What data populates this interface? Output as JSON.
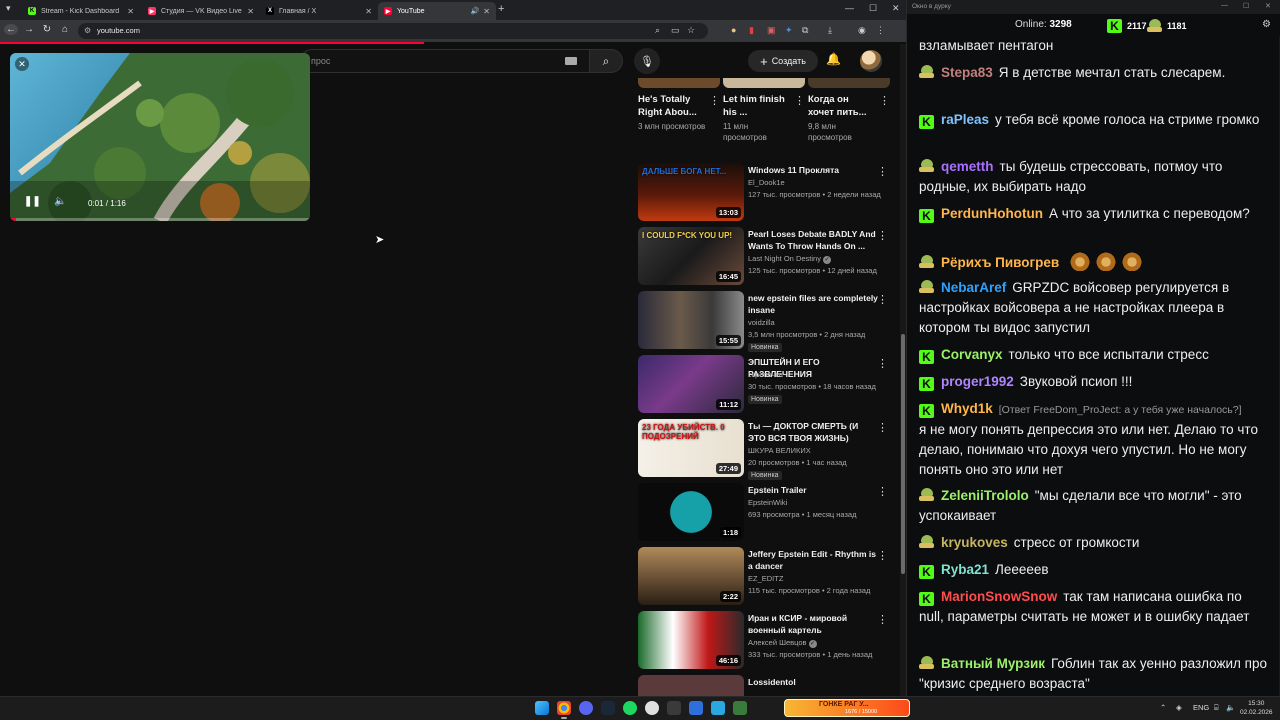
{
  "browser": {
    "tabs": [
      {
        "label": "Stream - Kick Dashboard",
        "fav_color": "#53fc18",
        "fav_glyph": "K",
        "active": false
      },
      {
        "label": "Студия — VK Видео Live",
        "fav_color": "#ff3366",
        "fav_glyph": "▶",
        "active": false
      },
      {
        "label": "Главная / X",
        "fav_color": "#ffffff",
        "fav_glyph": "X",
        "active": false
      },
      {
        "label": "YouTube",
        "fav_color": "#ff0033",
        "fav_glyph": "▶",
        "active": true
      }
    ],
    "new_tab_glyph": "+",
    "address": "youtube.com"
  },
  "youtube": {
    "search_placeholder": "прос",
    "create_label": "Создать",
    "miniplayer": {
      "time": "0:01 / 1:16",
      "progress": 0.02
    },
    "shorts": [
      {
        "title": "He's Totally Right Abou...",
        "views": "3 млн просмотров",
        "color": "#6b4b2a"
      },
      {
        "title": "Let him finish his ...",
        "views": "11 млн просмотров",
        "color": "#c9b99a"
      },
      {
        "title": "Когда он хочет пить...",
        "views": "9,8 млн просмотров",
        "color": "#4a3a2a"
      }
    ],
    "recommendations": [
      {
        "title": "Windows 11 Проклята",
        "channel": "El_Dook1e",
        "verified": false,
        "meta": "127 тыс. просмотров • 2 недели назад",
        "badge": "",
        "duration": "13:03",
        "thumb_text": "ДАЛЬШЕ БОГА НЕТ...",
        "thumb_bg": "linear-gradient(180deg,#1a0e0a,#5a1a0a 55%,#c23a10)",
        "accent": "#1e6fd9"
      },
      {
        "title": "Pearl Loses Debate BADLY And Wants To Throw Hands On ...",
        "channel": "Last Night On Destiny",
        "verified": true,
        "meta": "125 тыс. просмотров • 12 дней назад",
        "badge": "",
        "duration": "16:45",
        "thumb_text": "I COULD F*CK YOU UP!",
        "thumb_bg": "linear-gradient(135deg,#3a3a3a,#1a1a1a 50%,#6a4a3a)",
        "accent": "#f5d040"
      },
      {
        "title": "new epstein files are completely insane",
        "channel": "voidzilla",
        "verified": false,
        "meta": "3,5 млн просмотров • 2 дня назад",
        "badge": "Новинка",
        "duration": "15:55",
        "thumb_text": "",
        "thumb_bg": "linear-gradient(90deg,#2a2a3a,#6a5a4a 40%,#3a3a3a 70%,#8a8a8a)",
        "accent": "#c0b0a0"
      },
      {
        "title": "ЭПШТЕЙН И ЕГО РАЗВЛЕЧЕНИЯ",
        "channel": "скрепочка",
        "verified": false,
        "meta": "30 тыс. просмотров • 18 часов назад",
        "badge": "Новинка",
        "duration": "11:12",
        "thumb_text": "",
        "thumb_bg": "linear-gradient(135deg,#3a2a6a,#7a3a8a 45%,#2a2a3a)",
        "accent": "#e07a40"
      },
      {
        "title": "Ты — ДОКТОР СМЕРТЬ (И ЭТО ВСЯ ТВОЯ ЖИЗНЬ)",
        "channel": "ШКУРА ВЕЛИКИХ",
        "verified": false,
        "meta": "20 просмотров • 1 час назад",
        "badge": "Новинка",
        "duration": "27:49",
        "thumb_text": "23 ГОДА УБИЙСТВ. 0 ПОДОЗРЕНИЙ",
        "thumb_bg": "linear-gradient(90deg,#f4f0e8,#e8e0d0)",
        "accent": "#d01010"
      },
      {
        "title": "Epstein Trailer",
        "channel": "EpsteinWiki",
        "verified": false,
        "meta": "693 просмотра • 1 месяц назад",
        "badge": "",
        "duration": "1:18",
        "thumb_text": "",
        "thumb_bg": "radial-gradient(circle at 50% 50%,#16a0a8 0 34%,#0a0a0a 35%)",
        "accent": "#16a0a8"
      },
      {
        "title": "Jeffery Epstein Edit - Rhythm is a dancer",
        "channel": "EZ_EDITZ",
        "verified": false,
        "meta": "115 тыс. просмотров • 2 года назад",
        "badge": "",
        "duration": "2:22",
        "thumb_text": "",
        "thumb_bg": "linear-gradient(180deg,#b08a5a,#2a1e14)",
        "accent": "#1a1a1a"
      },
      {
        "title": "Иран и КСИР - мировой военный картель",
        "channel": "Алексей Шевцов",
        "verified": true,
        "meta": "333 тыс. просмотров • 1 день назад",
        "badge": "",
        "duration": "46:16",
        "thumb_text": "",
        "thumb_bg": "linear-gradient(90deg,#1a6a2a,#ffffff 33%,#c01818 66%,#2a2a2a)",
        "accent": "#e0c060"
      }
    ],
    "partial_title": "Lossidentol"
  },
  "chat_panel": {
    "window_title": "Окно в дурку",
    "online_label": "Online:",
    "online_count": "3298",
    "stat_kick": "2117",
    "stat_vk": "1181",
    "messages": [
      {
        "badge": "",
        "user": "",
        "color": "#efeff1",
        "text": "взламывает пентагон",
        "reply": ""
      },
      {
        "badge": "goblin",
        "user": "Stepa83",
        "color": "#c47f7f",
        "text": "Я в детстве мечтал стать слесарем.",
        "reply": ""
      },
      {
        "badge": "kick",
        "user": "raPleas",
        "color": "#7ec3ff",
        "text": "у тебя всё кроме голоса на стриме громко",
        "reply": ""
      },
      {
        "badge": "goblin",
        "user": "qemetth",
        "color": "#a970ff",
        "text": "ты будешь стрессовать, потмоу что родные, их выбирать надо",
        "reply": ""
      },
      {
        "badge": "kick",
        "user": "PerdunHohotun",
        "color": "#ffb64a",
        "text": "А что за утилитка с переводом?",
        "reply": ""
      },
      {
        "badge": "goblin",
        "user": "Рёрихъ Пивогрев",
        "color": "#ffb64a",
        "text": "",
        "reply": ""
      },
      {
        "badge": "goblin",
        "user": "NebarAref",
        "color": "#2fa2ff",
        "text": "GRPZDC войсовер регулируется в настройках войсовера а не настройках плеера в котором ты видос запустил",
        "reply": ""
      },
      {
        "badge": "kick",
        "user": "Corvanyx",
        "color": "#9cf06a",
        "text": "только что все испытали стресс",
        "reply": ""
      },
      {
        "badge": "kick",
        "user": "proger1992",
        "color": "#b085ff",
        "text": "Звуковой псиоп !!!",
        "reply": ""
      },
      {
        "badge": "kick",
        "user": "Whyd1k",
        "color": "#ffb64a",
        "text": "я не могу понять депрессия это или нет. Делаю то что делаю, понимаю что дохуя чего упустил. Но не могу понять оно это или нет",
        "reply": "[Ответ FreeDom_ProJect: а у тебя уже началось?]"
      },
      {
        "badge": "goblin",
        "user": "ZeleniiTrololo",
        "color": "#9cf06a",
        "text": "\"мы сделали все что могли\" - это успокаивает",
        "reply": ""
      },
      {
        "badge": "goblin",
        "user": "kryukoves",
        "color": "#c8b560",
        "text": "стресс от громкости",
        "reply": ""
      },
      {
        "badge": "kick",
        "user": "Ryba21",
        "color": "#7fe3d0",
        "text": "Лееееев",
        "reply": ""
      },
      {
        "badge": "kick",
        "user": "MarionSnowSnow",
        "color": "#ff4d4d",
        "text": "так там написана ошибка по null, параметры считать не может и в ошибку падает",
        "reply": ""
      },
      {
        "badge": "goblin",
        "user": "Ватный Мурзик",
        "color": "#9cf06a",
        "text": "Гоблин так ах уенно разложил про \"кризис среднего возраста\"",
        "reply": ""
      }
    ]
  },
  "taskbar": {
    "widget_text": "ГОНКЕ РАГ У...",
    "widget_sub": "1676 / 15000",
    "lang": "ENG",
    "time": "15:30",
    "date": "02.02.2026"
  }
}
